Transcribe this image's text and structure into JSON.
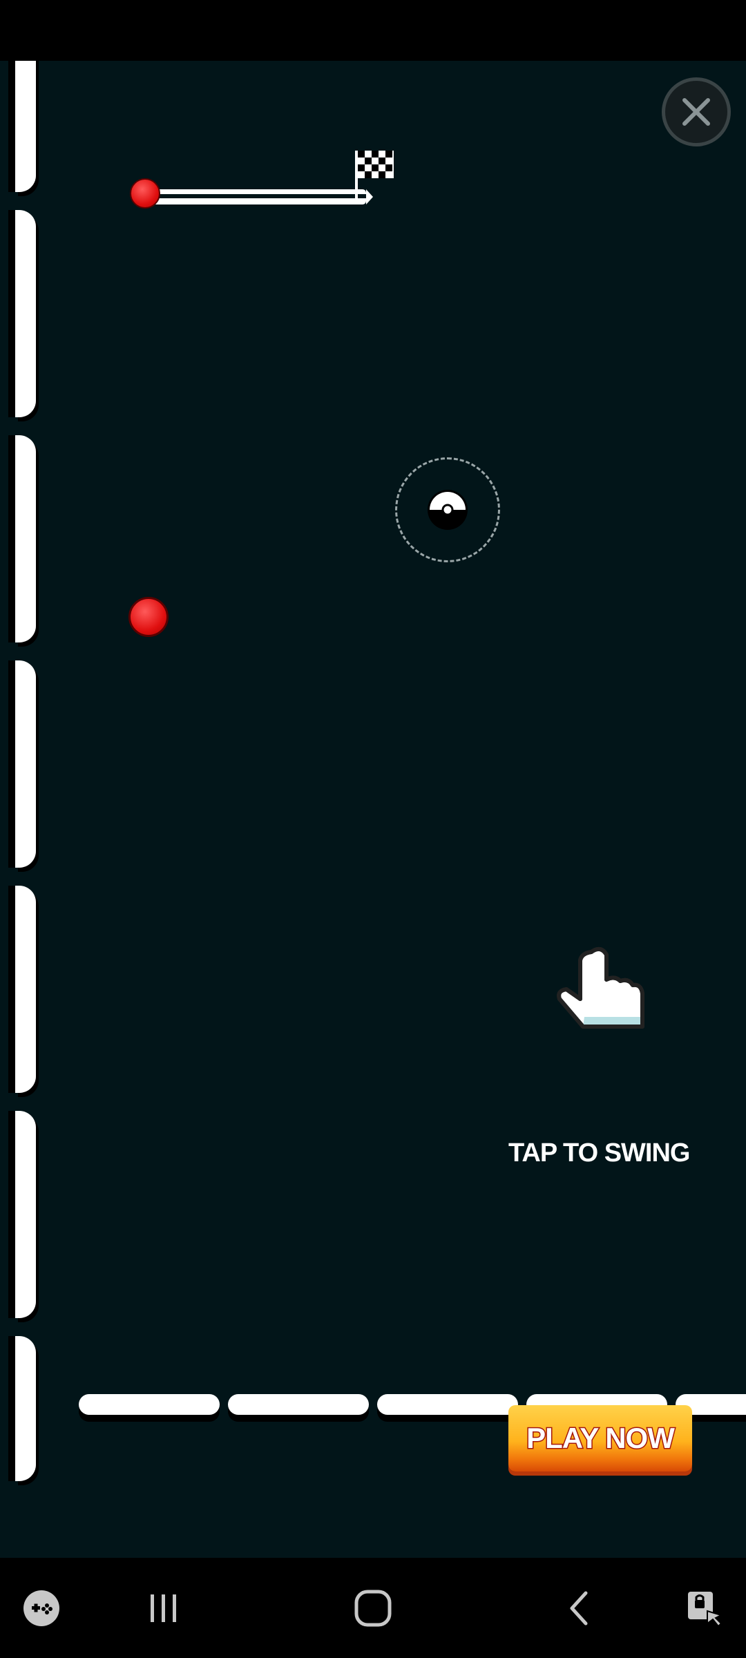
{
  "game": {
    "hint_text": "TAP TO SWING",
    "progress": 0.0,
    "close_icon": "close-icon",
    "flag_icon": "checkered-flag-icon",
    "hand_icon": "pointing-hand-icon"
  },
  "ad": {
    "cta_label": "PLAY NOW",
    "adchoices_icon": "ad-privacy-hand-shield-icon"
  },
  "nav": {
    "game_tools_icon": "game-tools-icon",
    "recents_icon": "recent-apps-icon",
    "home_icon": "home-icon",
    "back_icon": "back-icon",
    "screenshot_icon": "touch-lock-icon"
  },
  "colors": {
    "background": "#021519",
    "ball": "#e01010",
    "button_orange": "#ffb21c"
  }
}
